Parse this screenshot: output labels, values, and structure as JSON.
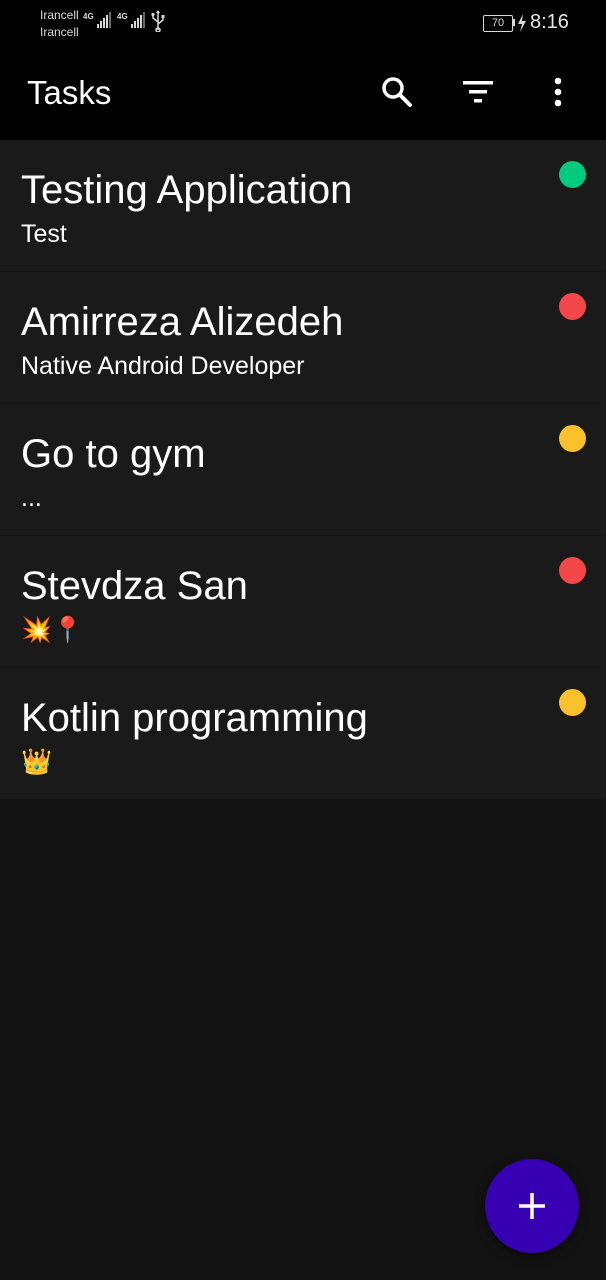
{
  "status_bar": {
    "carrier_1": "Irancell",
    "carrier_2": "Irancell",
    "network_1": "4G",
    "network_2": "4G",
    "battery_level": "70",
    "time": "8:16",
    "icons": [
      "signal-icon",
      "usb-icon",
      "battery-icon",
      "charging-icon"
    ]
  },
  "app_bar": {
    "title": "Tasks",
    "actions": [
      "search-icon",
      "filter-icon",
      "more-vert-icon"
    ]
  },
  "tasks": [
    {
      "title": "Testing Application",
      "description": "Test",
      "priority_color": "#00c980"
    },
    {
      "title": "Amirreza Alizedeh",
      "description": "Native Android Developer",
      "priority_color": "#f44747"
    },
    {
      "title": "Go to gym",
      "description": "...",
      "priority_color": "#fbc02d"
    },
    {
      "title": "Stevdza San",
      "description": "💥📍",
      "priority_color": "#f44747"
    },
    {
      "title": "Kotlin programming",
      "description": "👑",
      "priority_color": "#fbc02d"
    }
  ],
  "fab": {
    "icon": "add-icon",
    "color": "#3700b3"
  }
}
